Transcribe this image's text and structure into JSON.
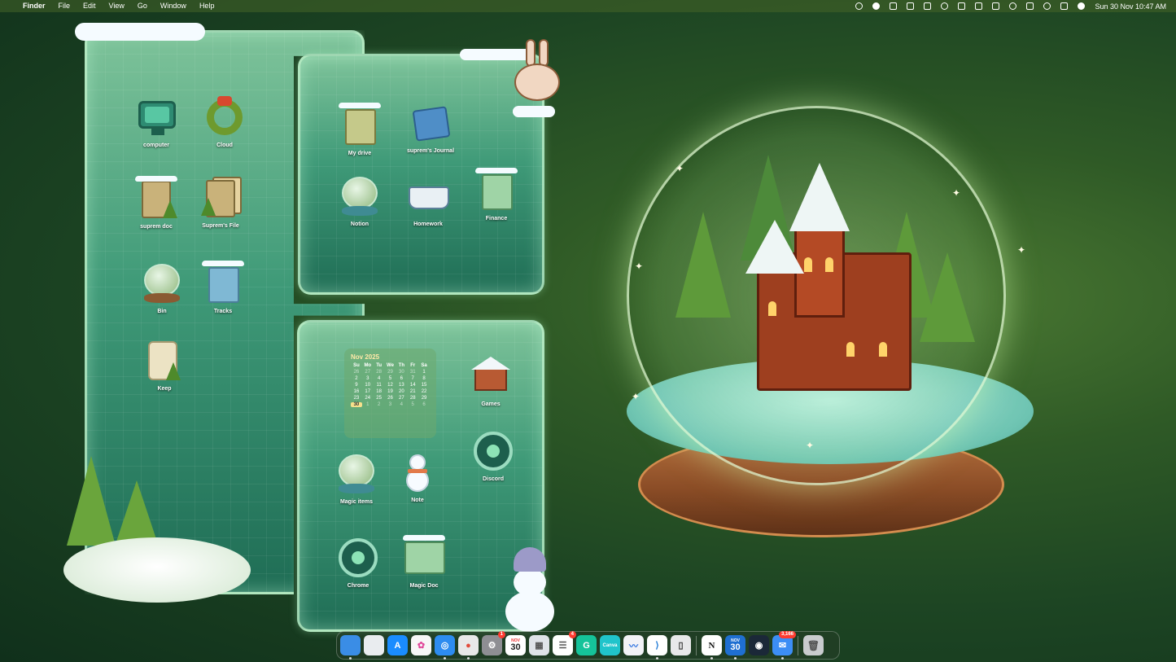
{
  "menubar": {
    "apple_glyph": "",
    "app_name": "Finder",
    "menus": [
      "File",
      "Edit",
      "View",
      "Go",
      "Window",
      "Help"
    ],
    "status_icons": [
      "cloud-icon",
      "d-app-icon",
      "notion-icon",
      "calendar-icon",
      "display-icon",
      "moon-icon",
      "sidebar-icon",
      "window-icon",
      "volume-icon",
      "wifi-icon",
      "bluetooth-icon",
      "search-icon",
      "control-center-icon",
      "flag-icon"
    ],
    "clock": "Sun 30 Nov  10:47 AM"
  },
  "icons_left": [
    {
      "name": "computer",
      "label": "computer"
    },
    {
      "name": "cloud",
      "label": "Cloud"
    },
    {
      "name": "suprem-doc",
      "label": "suprem doc"
    },
    {
      "name": "suprems-file",
      "label": "Suprem's File"
    },
    {
      "name": "bin",
      "label": "Bin"
    },
    {
      "name": "tracks",
      "label": "Tracks"
    },
    {
      "name": "keep",
      "label": "Keep"
    }
  ],
  "icons_top": [
    {
      "name": "my-drive",
      "label": "My drive"
    },
    {
      "name": "suprems-journal",
      "label": "suprem's Journal"
    },
    {
      "name": "notion",
      "label": "Notion"
    },
    {
      "name": "homework",
      "label": "Homework"
    },
    {
      "name": "finance",
      "label": "Finance"
    }
  ],
  "icons_bottom": [
    {
      "name": "games",
      "label": "Games"
    },
    {
      "name": "discord",
      "label": "Discord"
    },
    {
      "name": "magic-items",
      "label": "Magic items"
    },
    {
      "name": "note",
      "label": "Note"
    },
    {
      "name": "chrome",
      "label": "Chrome"
    },
    {
      "name": "magic-doc",
      "label": "Magic Doc"
    }
  ],
  "calendar": {
    "title": "Nov 2025",
    "weekdays": [
      "Su",
      "Mo",
      "Tu",
      "We",
      "Th",
      "Fr",
      "Sa"
    ],
    "days": [
      [
        "26",
        "27",
        "28",
        "29",
        "30",
        "31",
        "1"
      ],
      [
        "2",
        "3",
        "4",
        "5",
        "6",
        "7",
        "8"
      ],
      [
        "9",
        "10",
        "11",
        "12",
        "13",
        "14",
        "15"
      ],
      [
        "16",
        "17",
        "18",
        "19",
        "20",
        "21",
        "22"
      ],
      [
        "23",
        "24",
        "25",
        "26",
        "27",
        "28",
        "29"
      ],
      [
        "30",
        "1",
        "2",
        "3",
        "4",
        "5",
        "6"
      ]
    ],
    "today": "30"
  },
  "dock": {
    "items": [
      {
        "name": "finder",
        "color": "#3a8de6",
        "glyph": ""
      },
      {
        "name": "screenshot",
        "color": "#e9ecef",
        "glyph": ""
      },
      {
        "name": "app-store",
        "color": "#1a8cff",
        "glyph": "A"
      },
      {
        "name": "photos",
        "color": "#f7f7f7",
        "glyph": "✿"
      },
      {
        "name": "safari",
        "color": "#2d8cf0",
        "glyph": "◎"
      },
      {
        "name": "chrome",
        "color": "#e8e8e8",
        "glyph": "●"
      },
      {
        "name": "system-settings",
        "color": "#8e8e93",
        "glyph": "⚙",
        "badge": "1"
      },
      {
        "name": "calendar",
        "color": "#ffffff",
        "month": "NOV",
        "day": "30"
      },
      {
        "name": "launchpad",
        "color": "#dfe3e8",
        "glyph": "▦"
      },
      {
        "name": "reminders",
        "color": "#ffffff",
        "glyph": "☰",
        "badge": "4"
      },
      {
        "name": "grammarly",
        "color": "#15c39a",
        "glyph": "G"
      },
      {
        "name": "canva",
        "color": "#20c4cb",
        "glyph": "Canva"
      },
      {
        "name": "freeform",
        "color": "#f2f2f7",
        "glyph": "〰"
      },
      {
        "name": "vscode",
        "color": "#ffffff",
        "glyph": "⟩"
      },
      {
        "name": "iphone-mirroring",
        "color": "#e8e8ea",
        "glyph": "▯"
      }
    ],
    "items_right": [
      {
        "name": "notion",
        "color": "#ffffff",
        "glyph": "N"
      },
      {
        "name": "calendar-2",
        "color": "#1f6fd1",
        "month": "NOV",
        "day": "30"
      },
      {
        "name": "steam",
        "color": "#1b2838",
        "glyph": "◉"
      },
      {
        "name": "mail",
        "color": "#3c8ef5",
        "glyph": "✉",
        "badge": "3,166"
      }
    ],
    "trash": {
      "name": "trash",
      "color": "#c9cbce",
      "glyph": "🗑"
    }
  }
}
